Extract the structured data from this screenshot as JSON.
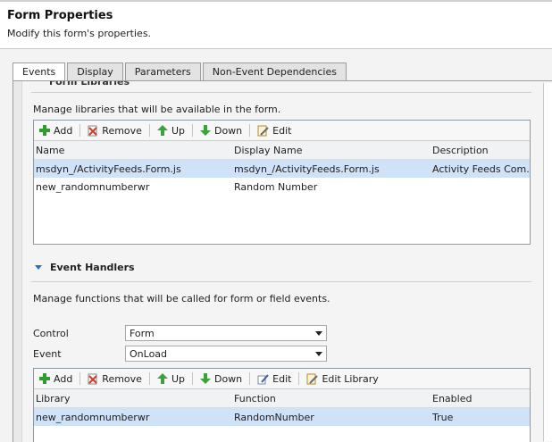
{
  "header": {
    "title": "Form Properties",
    "subtitle": "Modify this form's properties."
  },
  "tabs": [
    {
      "label": "Events",
      "active": true
    },
    {
      "label": "Display",
      "active": false
    },
    {
      "label": "Parameters",
      "active": false
    },
    {
      "label": "Non-Event Dependencies",
      "active": false
    }
  ],
  "form_libraries": {
    "heading": "Form Libraries",
    "description": "Manage libraries that will be available in the form.",
    "toolbar": {
      "add": "Add",
      "remove": "Remove",
      "up": "Up",
      "down": "Down",
      "edit": "Edit"
    },
    "columns": [
      "Name",
      "Display Name",
      "Description"
    ],
    "rows": [
      {
        "name": "msdyn_/ActivityFeeds.Form.js",
        "display_name": "msdyn_/ActivityFeeds.Form.js",
        "description": "Activity Feeds Com...",
        "selected": true
      },
      {
        "name": "new_randomnumberwr",
        "display_name": "Random Number",
        "description": "",
        "selected": false
      }
    ]
  },
  "event_handlers": {
    "heading": "Event Handlers",
    "description": "Manage functions that will be called for form or field events.",
    "control_label": "Control",
    "control_value": "Form",
    "event_label": "Event",
    "event_value": "OnLoad",
    "toolbar": {
      "add": "Add",
      "remove": "Remove",
      "up": "Up",
      "down": "Down",
      "edit": "Edit",
      "edit_library": "Edit Library"
    },
    "columns": [
      "Library",
      "Function",
      "Enabled"
    ],
    "rows": [
      {
        "library": "new_randomnumberwr",
        "function": "RandomNumber",
        "enabled": "True",
        "selected": true
      }
    ]
  },
  "colors": {
    "selected_row": "#cfe2f7",
    "add_icon": "#2e9e2e",
    "arrow_icon": "#3aa33a",
    "remove_icon": "#d23a2a"
  }
}
